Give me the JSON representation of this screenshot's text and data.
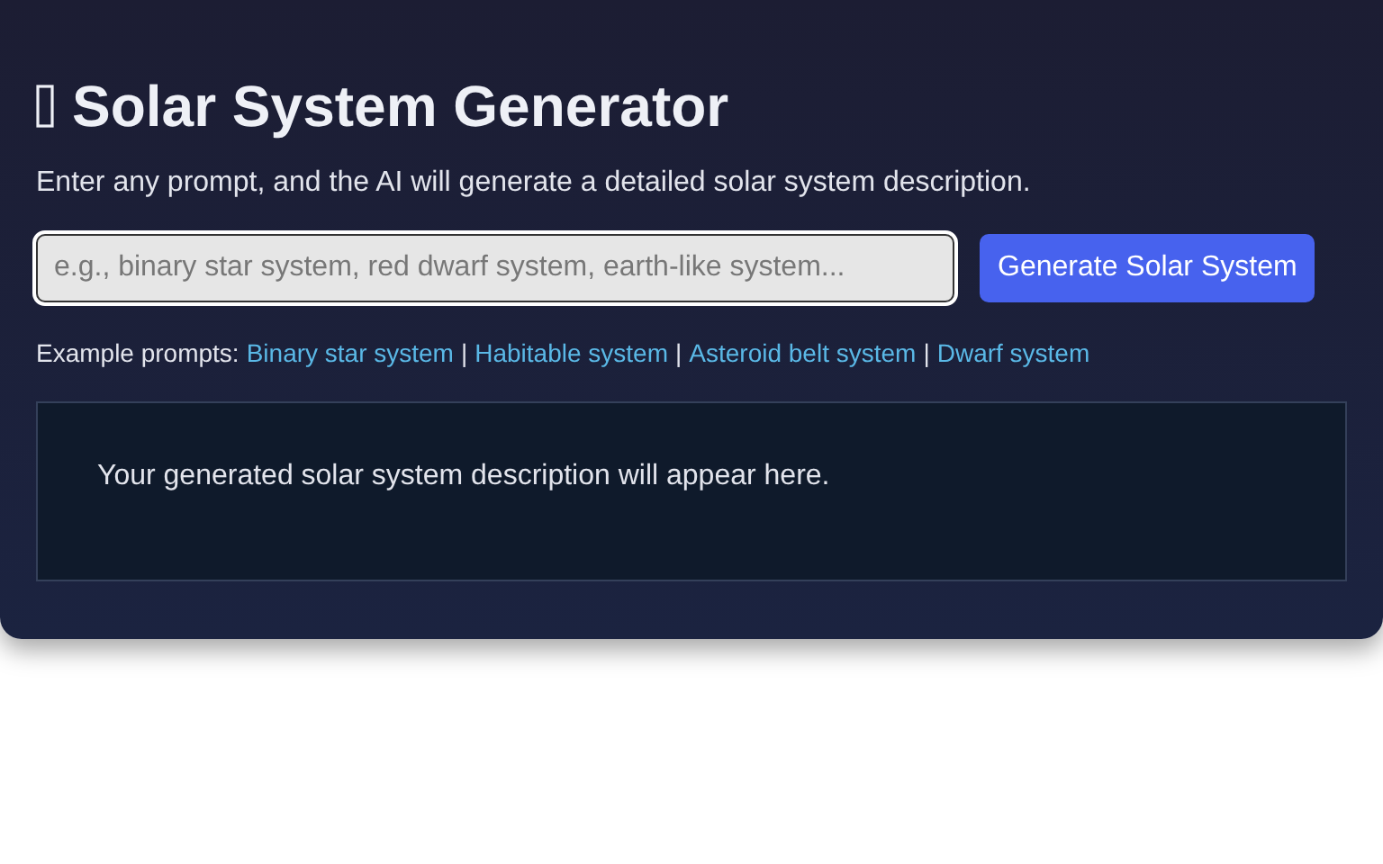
{
  "title": "Solar System Generator",
  "description": "Enter any prompt, and the AI will generate a detailed solar system description.",
  "prompt_field": {
    "placeholder": "e.g., binary star system, red dwarf system, earth-like system...",
    "focused": true
  },
  "generate_button": "Generate Solar System",
  "examples": {
    "label": "Example prompts:",
    "separator": "|",
    "links": [
      "Binary star system",
      "Habitable system",
      "Asteroid belt system",
      "Dwarf system"
    ]
  },
  "output": "Your generated solar system description will appear here."
}
